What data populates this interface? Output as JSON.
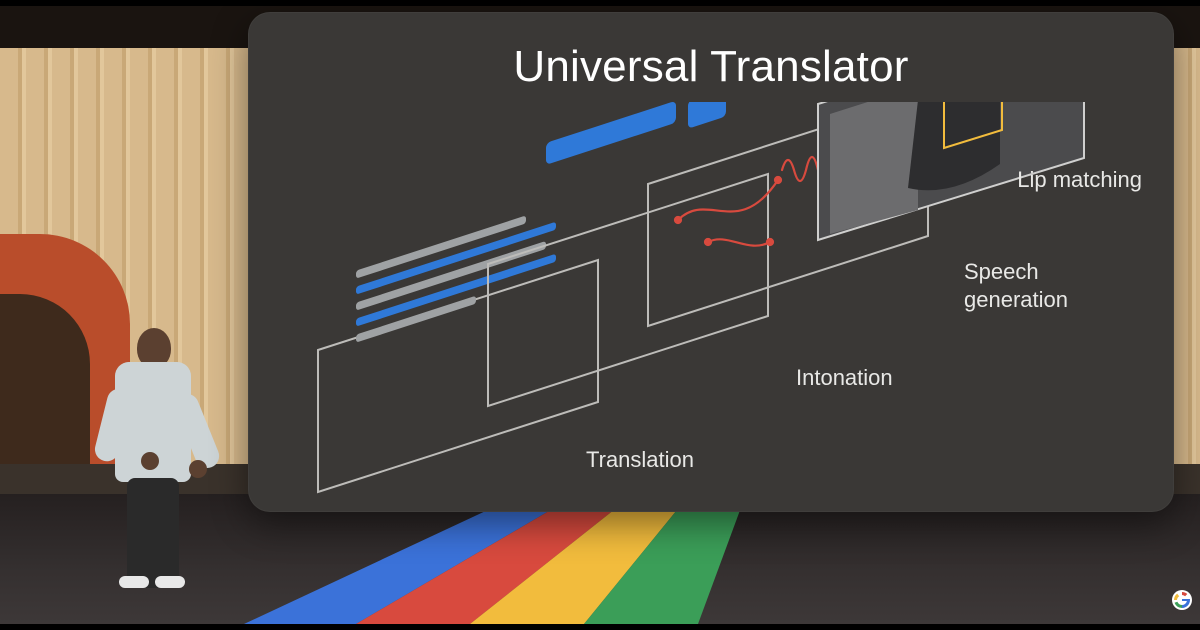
{
  "slide": {
    "title": "Universal Translator",
    "layers": [
      {
        "id": "lip",
        "label": "Lip matching"
      },
      {
        "id": "speech",
        "label": "Speech generation"
      },
      {
        "id": "intonation",
        "label": "Intonation"
      },
      {
        "id": "translation",
        "label": "Translation"
      }
    ]
  },
  "stage": {
    "rainbow_colors": [
      "#3b72d9",
      "#d84a3e",
      "#f2bc3d",
      "#3b9e58"
    ]
  }
}
